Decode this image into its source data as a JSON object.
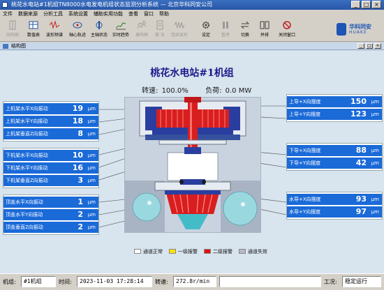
{
  "window": {
    "title": "桃花水电站#1机组TN8000水电发电机组状态监测分析系统 — 北京华科同安公司",
    "controls": [
      "_",
      "□",
      "×"
    ]
  },
  "menu": [
    "文件",
    "数据来源",
    "分析工具",
    "系统设置",
    "辅助实用功能",
    "查看",
    "窗口",
    "帮助"
  ],
  "toolbar": {
    "buttons": [
      {
        "label": "结构图",
        "icon": "structure-icon",
        "enabled": false
      },
      {
        "label": "数值表",
        "icon": "table-icon",
        "enabled": true
      },
      {
        "label": "波形频谱",
        "icon": "waveform-icon",
        "enabled": true
      },
      {
        "label": "轴心轨迹",
        "icon": "orbit-icon",
        "enabled": true
      },
      {
        "label": "主轴状态",
        "icon": "shaft-icon",
        "enabled": true
      },
      {
        "label": "实时趋势",
        "icon": "trend-icon",
        "enabled": true
      },
      {
        "label": "瀑布图",
        "icon": "waterfall-icon",
        "enabled": false
      },
      {
        "label": "报 告",
        "icon": "report-icon",
        "enabled": false
      },
      {
        "label": "连续波形",
        "icon": "continuous-icon",
        "enabled": false
      },
      {
        "label": "设定",
        "icon": "gear-icon",
        "enabled": true
      },
      {
        "label": "暂停",
        "icon": "pause-icon",
        "enabled": false
      },
      {
        "label": "切换",
        "icon": "switch-icon",
        "enabled": true
      },
      {
        "label": "并排",
        "icon": "tile-icon",
        "enabled": true
      },
      {
        "label": "关闭窗口",
        "icon": "close-window-icon",
        "enabled": true
      }
    ],
    "logo_cn": "华科同安",
    "logo_en": "HUAKE"
  },
  "subwindow": {
    "title": "结构图"
  },
  "station": {
    "title": "桃花水电站#1机组",
    "speed_label": "转速:",
    "speed_value": "100.0%",
    "load_label": "负荷:",
    "load_value": "0.0 MW"
  },
  "unit": "μm",
  "left_panels": [
    {
      "rows": [
        {
          "label": "上机架水平X向振动",
          "value": "19"
        },
        {
          "label": "上机架水平Y向振动",
          "value": "18"
        },
        {
          "label": "上机架垂直Z向振动",
          "value": "8"
        }
      ]
    },
    {
      "rows": [
        {
          "label": "下机架水平X向振动",
          "value": "10"
        },
        {
          "label": "下机架水平Y向振动",
          "value": "16"
        },
        {
          "label": "下机架垂直Z向振动",
          "value": "3"
        }
      ]
    },
    {
      "rows": [
        {
          "label": "顶盖水平X向振动",
          "value": "1"
        },
        {
          "label": "顶盖水平Y向振动",
          "value": "2"
        },
        {
          "label": "顶盖垂直Z向振动",
          "value": "2"
        }
      ]
    }
  ],
  "right_panels": [
    {
      "rows": [
        {
          "label": "上导+X向摆度",
          "value": "150"
        },
        {
          "label": "上导+Y向摆度",
          "value": "123"
        }
      ]
    },
    {
      "rows": [
        {
          "label": "下导+X向摆度",
          "value": "88"
        },
        {
          "label": "下导+Y向摆度",
          "value": "42"
        }
      ]
    },
    {
      "rows": [
        {
          "label": "水导+X向摆度",
          "value": "93"
        },
        {
          "label": "水导+Y向摆度",
          "value": "97"
        }
      ]
    }
  ],
  "legend": [
    {
      "label": "通道正常",
      "color": "#ffffff"
    },
    {
      "label": "一级报警",
      "color": "#ffe400"
    },
    {
      "label": "二级报警",
      "color": "#e01010"
    },
    {
      "label": "通道失效",
      "color": "#b8b8c8"
    }
  ],
  "colors": {
    "row_bg": "#1a6ad8",
    "generator_red": "#d81e1e",
    "stator_blue": "#2a3ea0",
    "water": "#9ad8e0"
  },
  "status": {
    "unit_label": "机组:",
    "unit_value": "#1机组",
    "time_label": "时间:",
    "time_value": "2023-11-03 17:28:14",
    "speed_label": "转速:",
    "speed_value": "272.8r/min",
    "condition_label": "工况:",
    "condition_value": "稳定运行"
  }
}
